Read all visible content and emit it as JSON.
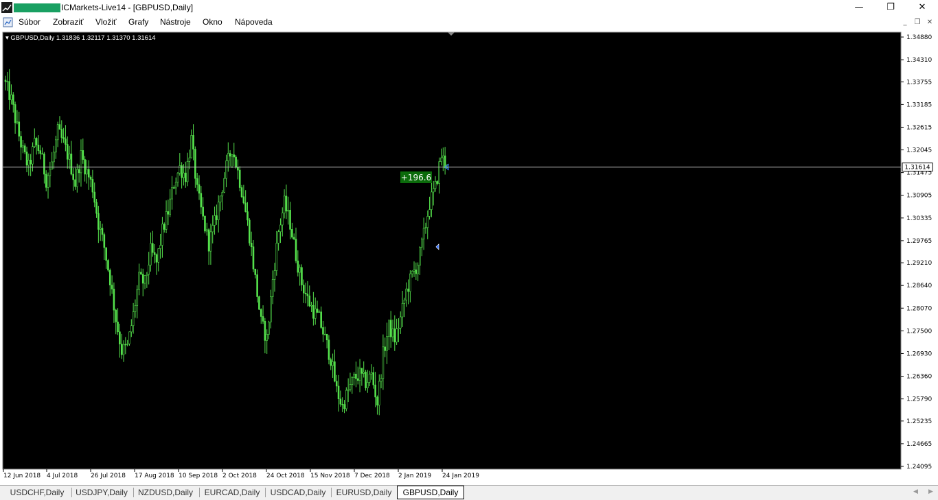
{
  "window": {
    "title": "ICMarkets-Live14 - [GBPUSD,Daily]",
    "minimize_glyph": "—",
    "restore_glyph": "❐",
    "close_glyph": "✕"
  },
  "menu": {
    "items": [
      "Súbor",
      "Zobraziť",
      "Vložiť",
      "Grafy",
      "Nástroje",
      "Okno",
      "Nápoveda"
    ]
  },
  "mdi": {
    "minimize_glyph": "_",
    "restore_glyph": "❐",
    "close_glyph": "✕"
  },
  "chart": {
    "header": "GBPUSD,Daily  1.31836 1.32117 1.31370 1.31614",
    "symbol": "GBPUSD",
    "timeframe": "Daily",
    "ohlc": {
      "open": "1.31836",
      "high": "1.32117",
      "low": "1.31370",
      "close": "1.31614"
    },
    "current_price_label": "1.31614",
    "profit_label": "+196.6",
    "colors": {
      "background": "#000000",
      "candles": "#55e24c",
      "price_line": "#c8c8c8",
      "profit_badge": "#0b6b0b",
      "axis_text": "#000000"
    }
  },
  "chart_data": {
    "type": "candlestick",
    "price_axis_labels": [
      "1.34880",
      "1.34310",
      "1.33755",
      "1.33185",
      "1.32615",
      "1.32045",
      "1.31475",
      "1.30905",
      "1.30335",
      "1.29765",
      "1.29210",
      "1.28640",
      "1.28070",
      "1.27500",
      "1.26930",
      "1.26360",
      "1.25790",
      "1.25235",
      "1.24665",
      "1.24095"
    ],
    "time_axis_labels": [
      "12 Jun 2018",
      "4 Jul 2018",
      "26 Jul 2018",
      "17 Aug 2018",
      "10 Sep 2018",
      "2 Oct 2018",
      "24 Oct 2018",
      "15 Nov 2018",
      "7 Dec 2018",
      "2 Jan 2019",
      "24 Jan 2019"
    ],
    "ylim": [
      1.24095,
      1.3488
    ],
    "current_price": 1.31614,
    "close_path": [
      [
        0,
        1.337
      ],
      [
        3,
        1.333
      ],
      [
        6,
        1.326
      ],
      [
        9,
        1.32
      ],
      [
        12,
        1.316
      ],
      [
        15,
        1.322
      ],
      [
        18,
        1.32
      ],
      [
        21,
        1.313
      ],
      [
        24,
        1.317
      ],
      [
        27,
        1.325
      ],
      [
        30,
        1.322
      ],
      [
        33,
        1.318
      ],
      [
        36,
        1.312
      ],
      [
        39,
        1.319
      ],
      [
        42,
        1.315
      ],
      [
        45,
        1.311
      ],
      [
        48,
        1.302
      ],
      [
        51,
        1.296
      ],
      [
        54,
        1.288
      ],
      [
        57,
        1.278
      ],
      [
        60,
        1.27
      ],
      [
        63,
        1.271
      ],
      [
        66,
        1.279
      ],
      [
        69,
        1.288
      ],
      [
        72,
        1.287
      ],
      [
        75,
        1.295
      ],
      [
        78,
        1.292
      ],
      [
        81,
        1.3
      ],
      [
        84,
        1.305
      ],
      [
        87,
        1.312
      ],
      [
        90,
        1.316
      ],
      [
        93,
        1.314
      ],
      [
        96,
        1.323
      ],
      [
        99,
        1.31
      ],
      [
        102,
        1.303
      ],
      [
        105,
        1.297
      ],
      [
        108,
        1.302
      ],
      [
        111,
        1.309
      ],
      [
        114,
        1.316
      ],
      [
        117,
        1.321
      ],
      [
        120,
        1.315
      ],
      [
        123,
        1.308
      ],
      [
        126,
        1.299
      ],
      [
        129,
        1.288
      ],
      [
        132,
        1.277
      ],
      [
        135,
        1.273
      ],
      [
        138,
        1.288
      ],
      [
        141,
        1.3
      ],
      [
        144,
        1.307
      ],
      [
        147,
        1.302
      ],
      [
        150,
        1.294
      ],
      [
        153,
        1.287
      ],
      [
        156,
        1.283
      ],
      [
        159,
        1.28
      ],
      [
        162,
        1.278
      ],
      [
        165,
        1.273
      ],
      [
        168,
        1.268
      ],
      [
        171,
        1.26
      ],
      [
        174,
        1.256
      ],
      [
        177,
        1.26
      ],
      [
        180,
        1.263
      ],
      [
        183,
        1.264
      ],
      [
        186,
        1.262
      ],
      [
        189,
        1.264
      ],
      [
        192,
        1.257
      ],
      [
        195,
        1.269
      ],
      [
        198,
        1.276
      ],
      [
        201,
        1.273
      ],
      [
        204,
        1.278
      ],
      [
        207,
        1.285
      ],
      [
        210,
        1.289
      ],
      [
        213,
        1.292
      ],
      [
        216,
        1.299
      ],
      [
        219,
        1.307
      ],
      [
        222,
        1.311
      ],
      [
        225,
        1.319
      ],
      [
        228,
        1.3161
      ]
    ],
    "trade_markers": [
      {
        "label": "entry",
        "date": "21 Jan 2019",
        "price": 1.2961
      },
      {
        "label": "current",
        "date": "29 Jan 2019",
        "price": 1.31614
      }
    ]
  },
  "tabs": [
    "USDCHF,Daily",
    "USDJPY,Daily",
    "NZDUSD,Daily",
    "EURCAD,Daily",
    "USDCAD,Daily",
    "EURUSD,Daily",
    "GBPUSD,Daily"
  ],
  "active_tab": "GBPUSD,Daily",
  "tabs_scroll": {
    "left": "◀",
    "right": "▶"
  }
}
